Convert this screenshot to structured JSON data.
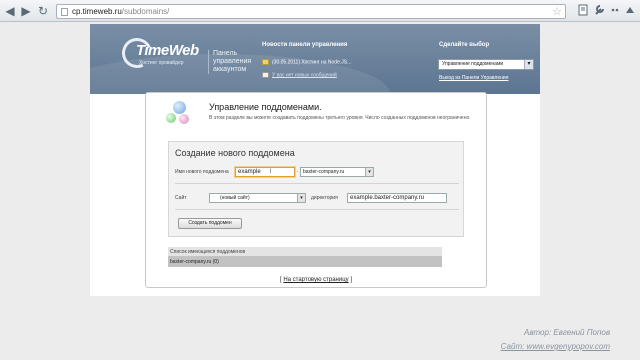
{
  "browser": {
    "back": "◀",
    "forward": "▶",
    "reload": "↻",
    "url_host": "cp.timeweb.ru",
    "url_path": "/subdomains/",
    "star": "☆",
    "icons": [
      "star-icon",
      "page-icon",
      "wrench-icon"
    ]
  },
  "header": {
    "logo_text": "TimeWeb",
    "logo_sub": "Хостинг провайдер",
    "panel_title": "Панель управления аккаунтом",
    "news_heading": "Новости панели управления",
    "news": [
      {
        "text": "(30.05.2011) Хостинг на Node.JS..."
      },
      {
        "text": "У вас нет новых сообщений"
      }
    ],
    "choice_heading": "Сделайте выбор",
    "choice_value": "Управление поддоменами",
    "logout": "Выход из Панели Управления"
  },
  "main": {
    "title": "Управление поддоменами.",
    "description": "В этом разделе вы можете создавать поддомены третьего уровня. Число созданных поддоменов неограничено."
  },
  "form": {
    "title": "Создание нового поддомена",
    "name_label": "Имя нового поддомена",
    "name_value": "example",
    "dot": ".",
    "domain_value": "baxter-company.ru",
    "site_label": "Сайт",
    "site_value": "(новый сайт)",
    "dir_label": "директория",
    "dir_value": "example.baxter-company.ru",
    "submit": "Создать поддомен"
  },
  "list": {
    "heading": "Список имеющихся поддоменов",
    "rows": [
      "baxter-company.ru (0)"
    ]
  },
  "home_link": {
    "bracket_open": "[",
    "text": "На стартовую страницу",
    "bracket_close": "]"
  },
  "watermark": {
    "line1": "Автор: Евгений Попов",
    "line2": "Сайт: www.evgenypopov.com"
  }
}
